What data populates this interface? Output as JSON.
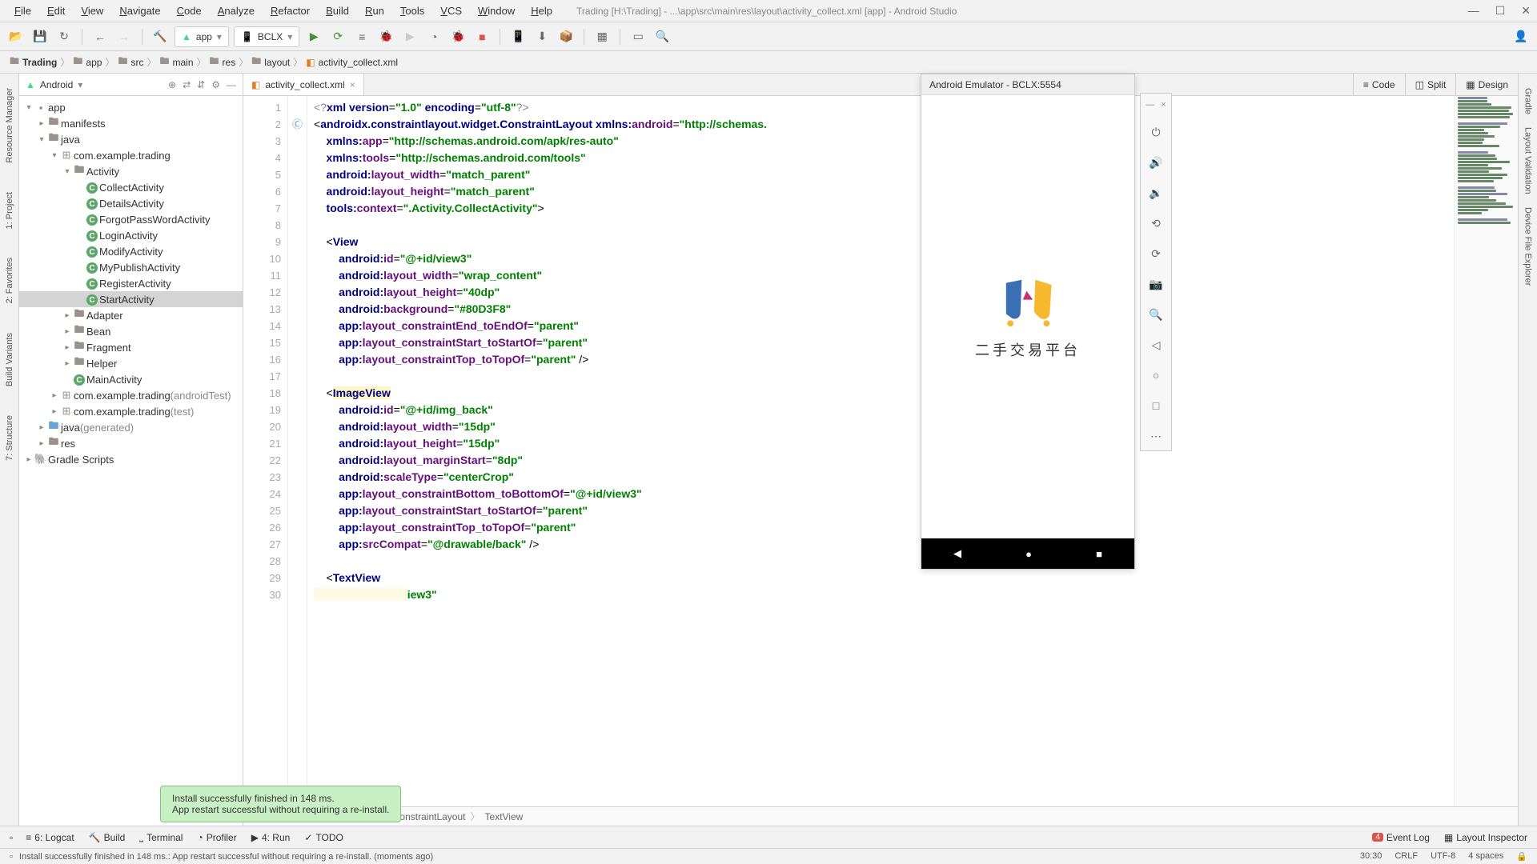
{
  "menubar": {
    "items": [
      "File",
      "Edit",
      "View",
      "Navigate",
      "Code",
      "Analyze",
      "Refactor",
      "Build",
      "Run",
      "Tools",
      "VCS",
      "Window",
      "Help"
    ],
    "title": "Trading [H:\\Trading] - ...\\app\\src\\main\\res\\layout\\activity_collect.xml [app] - Android Studio"
  },
  "toolbar": {
    "app_config": "app",
    "device": "BCLX"
  },
  "breadcrumbs": [
    "Trading",
    "app",
    "src",
    "main",
    "res",
    "layout",
    "activity_collect.xml"
  ],
  "project_panel": {
    "title": "Android",
    "tree": {
      "app": "app",
      "manifests": "manifests",
      "java": "java",
      "package1": "com.example.trading",
      "activity_folder": "Activity",
      "activities": [
        "CollectActivity",
        "DetailsActivity",
        "ForgotPassWordActivity",
        "LoginActivity",
        "ModifyActivity",
        "MyPublishActivity",
        "RegisterActivity",
        "StartActivity"
      ],
      "folders2": [
        "Adapter",
        "Bean",
        "Fragment",
        "Helper"
      ],
      "main_activity": "MainActivity",
      "package2": "com.example.trading",
      "package2_suffix": "(androidTest)",
      "package3": "com.example.trading",
      "package3_suffix": "(test)",
      "java_gen": "java",
      "java_gen_suffix": "(generated)",
      "res": "res",
      "gradle": "Gradle Scripts"
    }
  },
  "editor": {
    "tab": "activity_collect.xml",
    "view_modes": [
      "Code",
      "Split",
      "Design"
    ],
    "breadcrumb": [
      "androidx.constraintlayout.widget.ConstraintLayout",
      "TextView"
    ],
    "code_lines": [
      [
        {
          "t": "<?",
          "c": "xml"
        },
        {
          "t": "xml version",
          "c": "attr-ns"
        },
        {
          "t": "=",
          "c": "p"
        },
        {
          "t": "\"1.0\"",
          "c": "str"
        },
        {
          "t": " encoding",
          "c": "attr-ns"
        },
        {
          "t": "=",
          "c": "p"
        },
        {
          "t": "\"utf-8\"",
          "c": "str"
        },
        {
          "t": "?>",
          "c": "xml"
        }
      ],
      [
        {
          "t": "<",
          "c": "p"
        },
        {
          "t": "androidx.constraintlayout.widget.ConstraintLayout",
          "c": "tag"
        },
        {
          "t": " xmlns:",
          "c": "attr-ns"
        },
        {
          "t": "android",
          "c": "attr"
        },
        {
          "t": "=",
          "c": "p"
        },
        {
          "t": "\"http://schemas.",
          "c": "str"
        }
      ],
      [
        {
          "t": "    xmlns:",
          "c": "attr-ns"
        },
        {
          "t": "app",
          "c": "attr"
        },
        {
          "t": "=",
          "c": "p"
        },
        {
          "t": "\"http://schemas.android.com/apk/res-auto\"",
          "c": "str"
        }
      ],
      [
        {
          "t": "    xmlns:",
          "c": "attr-ns"
        },
        {
          "t": "tools",
          "c": "attr"
        },
        {
          "t": "=",
          "c": "p"
        },
        {
          "t": "\"http://schemas.android.com/tools\"",
          "c": "str"
        }
      ],
      [
        {
          "t": "    android:",
          "c": "attr-ns"
        },
        {
          "t": "layout_width",
          "c": "attr"
        },
        {
          "t": "=",
          "c": "p"
        },
        {
          "t": "\"match_parent\"",
          "c": "str"
        }
      ],
      [
        {
          "t": "    android:",
          "c": "attr-ns"
        },
        {
          "t": "layout_height",
          "c": "attr"
        },
        {
          "t": "=",
          "c": "p"
        },
        {
          "t": "\"match_parent\"",
          "c": "str"
        }
      ],
      [
        {
          "t": "    tools:",
          "c": "attr-ns"
        },
        {
          "t": "context",
          "c": "attr"
        },
        {
          "t": "=",
          "c": "p"
        },
        {
          "t": "\".Activity.CollectActivity\"",
          "c": "str"
        },
        {
          "t": ">",
          "c": "p"
        }
      ],
      [],
      [
        {
          "t": "    <",
          "c": "p"
        },
        {
          "t": "View",
          "c": "tag"
        }
      ],
      [
        {
          "t": "        android:",
          "c": "attr-ns"
        },
        {
          "t": "id",
          "c": "attr"
        },
        {
          "t": "=",
          "c": "p"
        },
        {
          "t": "\"@+id/view3\"",
          "c": "str"
        }
      ],
      [
        {
          "t": "        android:",
          "c": "attr-ns"
        },
        {
          "t": "layout_width",
          "c": "attr"
        },
        {
          "t": "=",
          "c": "p"
        },
        {
          "t": "\"wrap_content\"",
          "c": "str"
        }
      ],
      [
        {
          "t": "        android:",
          "c": "attr-ns"
        },
        {
          "t": "layout_height",
          "c": "attr"
        },
        {
          "t": "=",
          "c": "p"
        },
        {
          "t": "\"40dp\"",
          "c": "str"
        }
      ],
      [
        {
          "t": "        android:",
          "c": "attr-ns"
        },
        {
          "t": "background",
          "c": "attr"
        },
        {
          "t": "=",
          "c": "p"
        },
        {
          "t": "\"#80D3F8\"",
          "c": "str"
        }
      ],
      [
        {
          "t": "        app:",
          "c": "attr-ns"
        },
        {
          "t": "layout_constraintEnd_toEndOf",
          "c": "attr"
        },
        {
          "t": "=",
          "c": "p"
        },
        {
          "t": "\"parent\"",
          "c": "str"
        }
      ],
      [
        {
          "t": "        app:",
          "c": "attr-ns"
        },
        {
          "t": "layout_constraintStart_toStartOf",
          "c": "attr"
        },
        {
          "t": "=",
          "c": "p"
        },
        {
          "t": "\"parent\"",
          "c": "str"
        }
      ],
      [
        {
          "t": "        app:",
          "c": "attr-ns"
        },
        {
          "t": "layout_constraintTop_toTopOf",
          "c": "attr"
        },
        {
          "t": "=",
          "c": "p"
        },
        {
          "t": "\"parent\"",
          "c": "str"
        },
        {
          "t": " />",
          "c": "p"
        }
      ],
      [],
      [
        {
          "t": "    <",
          "c": "p"
        },
        {
          "t": "ImageView",
          "c": "tag",
          "hl": "y"
        }
      ],
      [
        {
          "t": "        android:",
          "c": "attr-ns"
        },
        {
          "t": "id",
          "c": "attr"
        },
        {
          "t": "=",
          "c": "p"
        },
        {
          "t": "\"@+id/img_back\"",
          "c": "str"
        }
      ],
      [
        {
          "t": "        android:",
          "c": "attr-ns"
        },
        {
          "t": "layout_width",
          "c": "attr"
        },
        {
          "t": "=",
          "c": "p"
        },
        {
          "t": "\"15dp\"",
          "c": "str"
        }
      ],
      [
        {
          "t": "        android:",
          "c": "attr-ns"
        },
        {
          "t": "layout_height",
          "c": "attr"
        },
        {
          "t": "=",
          "c": "p"
        },
        {
          "t": "\"15dp\"",
          "c": "str"
        }
      ],
      [
        {
          "t": "        android:",
          "c": "attr-ns"
        },
        {
          "t": "layout_marginStart",
          "c": "attr"
        },
        {
          "t": "=",
          "c": "p"
        },
        {
          "t": "\"8dp\"",
          "c": "str"
        }
      ],
      [
        {
          "t": "        android:",
          "c": "attr-ns"
        },
        {
          "t": "scaleType",
          "c": "attr"
        },
        {
          "t": "=",
          "c": "p"
        },
        {
          "t": "\"centerCrop\"",
          "c": "str"
        }
      ],
      [
        {
          "t": "        app:",
          "c": "attr-ns"
        },
        {
          "t": "layout_constraintBottom_toBottomOf",
          "c": "attr"
        },
        {
          "t": "=",
          "c": "p"
        },
        {
          "t": "\"@+id/view3\"",
          "c": "str"
        }
      ],
      [
        {
          "t": "        app:",
          "c": "attr-ns"
        },
        {
          "t": "layout_constraintStart_toStartOf",
          "c": "attr"
        },
        {
          "t": "=",
          "c": "p"
        },
        {
          "t": "\"parent\"",
          "c": "str"
        }
      ],
      [
        {
          "t": "        app:",
          "c": "attr-ns"
        },
        {
          "t": "layout_constraintTop_toTopOf",
          "c": "attr"
        },
        {
          "t": "=",
          "c": "p"
        },
        {
          "t": "\"parent\"",
          "c": "str"
        }
      ],
      [
        {
          "t": "        app:",
          "c": "attr-ns"
        },
        {
          "t": "srcCompat",
          "c": "attr"
        },
        {
          "t": "=",
          "c": "p"
        },
        {
          "t": "\"@drawable/back\"",
          "c": "str"
        },
        {
          "t": " />",
          "c": "p"
        }
      ],
      [],
      [
        {
          "t": "    <",
          "c": "p"
        },
        {
          "t": "TextView",
          "c": "tag"
        }
      ],
      [
        {
          "t": "                              ",
          "c": "p",
          "hl": "c"
        },
        {
          "t": "iew3\"",
          "c": "str"
        }
      ]
    ]
  },
  "emulator": {
    "title": "Android Emulator - BCLX:5554",
    "app_text": "二手交易平台"
  },
  "toast": {
    "line1": "Install successfully finished in 148 ms.",
    "line2": "App restart successful without requiring a re-install."
  },
  "bottom_toolbar": {
    "items": [
      "6: Logcat",
      "Build",
      "Terminal",
      "Profiler",
      "4: Run",
      "TODO"
    ],
    "right": {
      "event_log": "Event Log",
      "event_badge": "4",
      "layout_inspector": "Layout Inspector"
    }
  },
  "statusbar": {
    "message": "Install successfully finished in 148 ms.: App restart successful without requiring a re-install. (moments ago)",
    "cursor": "30:30",
    "line_ending": "CRLF",
    "encoding": "UTF-8",
    "indent": "4 spaces"
  },
  "left_tools": [
    "Resource Manager",
    "1: Project",
    "2: Favorites",
    "Build Variants",
    "7: Structure"
  ],
  "right_tools": [
    "Gradle",
    "Layout Validation",
    "Device File Explorer"
  ]
}
